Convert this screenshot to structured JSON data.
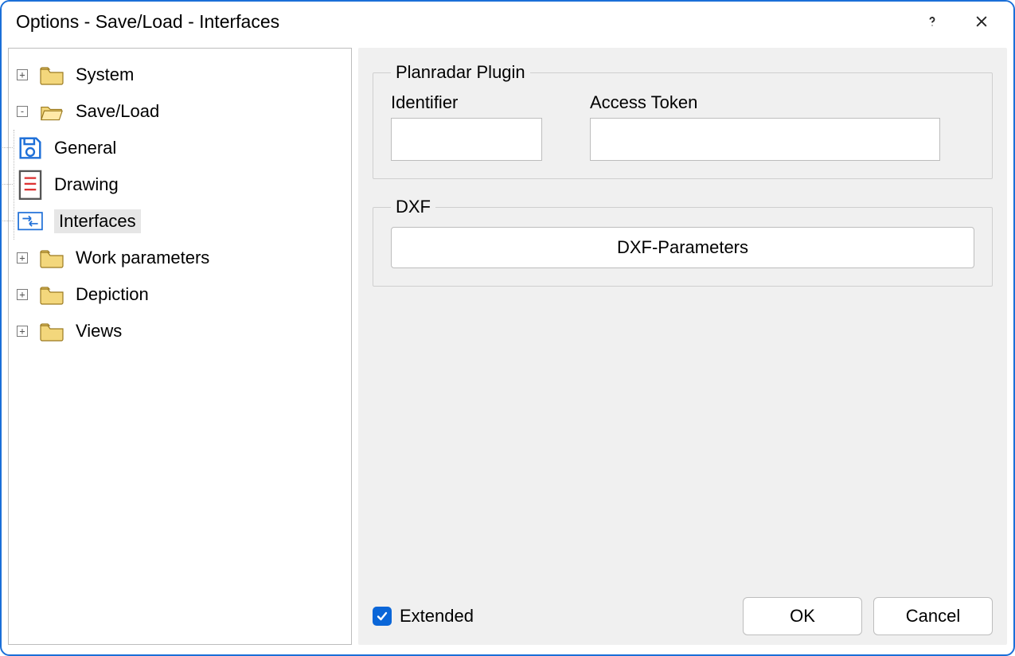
{
  "window": {
    "title": "Options - Save/Load - Interfaces"
  },
  "tree": {
    "system": "System",
    "saveload": "Save/Load",
    "general": "General",
    "drawing": "Drawing",
    "interfaces": "Interfaces",
    "work_parameters": "Work parameters",
    "depiction": "Depiction",
    "views": "Views"
  },
  "panel": {
    "planradar_legend": "Planradar Plugin",
    "identifier_label": "Identifier",
    "identifier_value": "",
    "token_label": "Access Token",
    "token_value": "",
    "dxf_legend": "DXF",
    "dxf_button": "DXF-Parameters"
  },
  "footer": {
    "extended_label": "Extended",
    "extended_checked": true,
    "ok": "OK",
    "cancel": "Cancel"
  },
  "icons": {
    "folder": "folder-icon",
    "folder_open": "folder-open-icon",
    "save_disk": "save-disk-icon",
    "drawing": "drawing-icon",
    "interfaces": "interfaces-icon"
  }
}
